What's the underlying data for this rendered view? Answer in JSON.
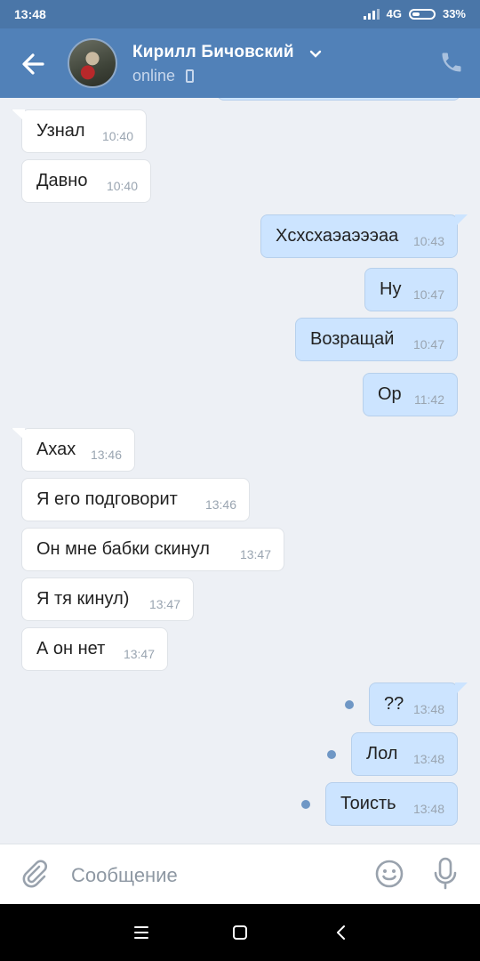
{
  "status": {
    "time": "13:48",
    "network": "4G",
    "battery": "33%"
  },
  "header": {
    "contact_name": "Кирилл Бичовский",
    "status": "online"
  },
  "messages": [
    {
      "dir": "in",
      "text": "Узнал",
      "time": "10:40",
      "tail": true,
      "unread": false
    },
    {
      "dir": "in",
      "text": "Давно",
      "time": "10:40",
      "tail": false,
      "unread": false
    },
    {
      "dir": "out",
      "text": "Хсхсхаэаэээаа",
      "time": "10:43",
      "tail": true,
      "unread": false
    },
    {
      "dir": "out",
      "text": "Ну",
      "time": "10:47",
      "tail": false,
      "unread": false
    },
    {
      "dir": "out",
      "text": "Возращай",
      "time": "10:47",
      "tail": false,
      "unread": false
    },
    {
      "dir": "out",
      "text": "Ор",
      "time": "11:42",
      "tail": false,
      "unread": false
    },
    {
      "dir": "in",
      "text": "Ахах",
      "time": "13:46",
      "tail": true,
      "unread": false
    },
    {
      "dir": "in",
      "text": "Я его подговорит",
      "time": "13:46",
      "tail": false,
      "unread": false
    },
    {
      "dir": "in",
      "text": "Он мне бабки скинул",
      "time": "13:47",
      "tail": false,
      "unread": false
    },
    {
      "dir": "in",
      "text": "Я тя кинул)",
      "time": "13:47",
      "tail": false,
      "unread": false
    },
    {
      "dir": "in",
      "text": "А он нет",
      "time": "13:47",
      "tail": false,
      "unread": false
    },
    {
      "dir": "out",
      "text": "??",
      "time": "13:48",
      "tail": true,
      "unread": true
    },
    {
      "dir": "out",
      "text": "Лол",
      "time": "13:48",
      "tail": false,
      "unread": true
    },
    {
      "dir": "out",
      "text": "Тоисть",
      "time": "13:48",
      "tail": false,
      "unread": true
    }
  ],
  "composer": {
    "placeholder": "Сообщение"
  },
  "icons": {
    "back": "arrow-left-icon",
    "call": "phone-icon",
    "attach": "paperclip-icon",
    "emoji": "smile-icon",
    "mic": "microphone-icon",
    "nav_menu": "menu-icon",
    "nav_home": "square-icon",
    "nav_back": "chevron-left-icon"
  },
  "colors": {
    "header": "#5181b8",
    "statusbar": "#4a76a8",
    "chat_bg": "#edf0f5",
    "outgoing": "#cce4ff",
    "incoming": "#ffffff",
    "unread_dot": "#6f97c5"
  }
}
